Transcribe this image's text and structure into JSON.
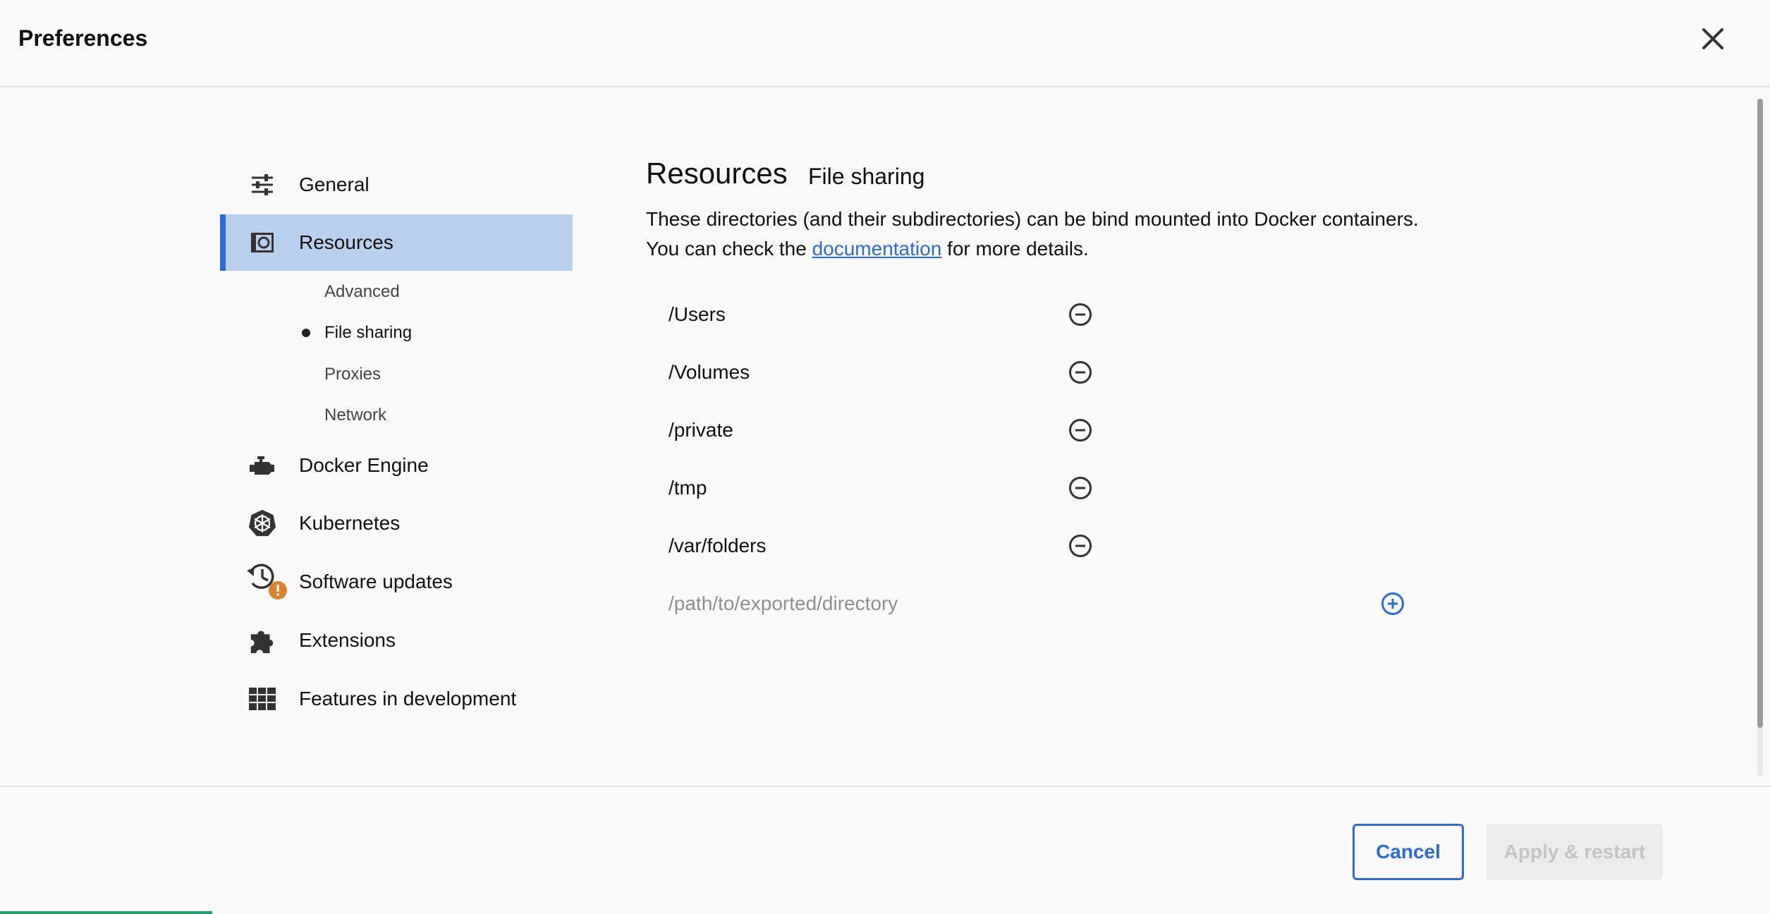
{
  "header": {
    "title": "Preferences"
  },
  "sidebar": {
    "items": [
      {
        "label": "General",
        "icon": "sliders-icon"
      },
      {
        "label": "Resources",
        "icon": "resources-icon",
        "active": true
      },
      {
        "label": "Docker Engine",
        "icon": "engine-icon"
      },
      {
        "label": "Kubernetes",
        "icon": "kubernetes-icon"
      },
      {
        "label": "Software updates",
        "icon": "update-history-icon",
        "badge": "!"
      },
      {
        "label": "Extensions",
        "icon": "puzzle-icon"
      },
      {
        "label": "Features in development",
        "icon": "grid-icon"
      }
    ],
    "subitems": [
      {
        "label": "Advanced"
      },
      {
        "label": "File sharing",
        "current": true
      },
      {
        "label": "Proxies"
      },
      {
        "label": "Network"
      }
    ]
  },
  "content": {
    "title": "Resources",
    "subtitle": "File sharing",
    "description_line1": "These directories (and their subdirectories) can be bind mounted into Docker containers.",
    "description_prefix": "You can check the ",
    "description_link": "documentation",
    "description_suffix": " for more details.",
    "directories": [
      "/Users",
      "/Volumes",
      "/private",
      "/tmp",
      "/var/folders"
    ],
    "new_path_placeholder": "/path/to/exported/directory",
    "new_path_value": ""
  },
  "footer": {
    "cancel_label": "Cancel",
    "apply_label": "Apply & restart",
    "progress_fraction": 0.12
  },
  "colors": {
    "accent": "#2c6cd6",
    "active_bg": "#b9cfee",
    "warning_badge": "#d9822b",
    "progress": "#1e9f6d"
  }
}
